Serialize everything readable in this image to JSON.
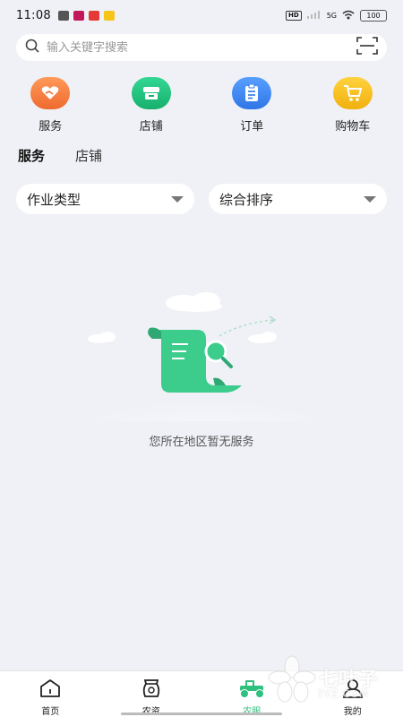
{
  "status_bar": {
    "time": "11:08",
    "network_label": "5G",
    "battery": "100"
  },
  "search": {
    "placeholder": "输入关键字搜索"
  },
  "quick_actions": [
    {
      "label": "服务",
      "icon": "heart-hand-icon",
      "color": "#f07a3a"
    },
    {
      "label": "店铺",
      "icon": "store-icon",
      "color": "#22c17f"
    },
    {
      "label": "订单",
      "icon": "order-clipboard-icon",
      "color": "#3a87f0"
    },
    {
      "label": "购物车",
      "icon": "cart-icon",
      "color": "#f3bd1f"
    }
  ],
  "tabs": [
    {
      "label": "服务",
      "active": true
    },
    {
      "label": "店铺",
      "active": false
    }
  ],
  "filters": {
    "type_label": "作业类型",
    "sort_label": "综合排序"
  },
  "empty_state": {
    "message": "您所在地区暂无服务"
  },
  "bottom_nav": [
    {
      "label": "首页",
      "icon": "home-icon"
    },
    {
      "label": "农资",
      "icon": "fertilizer-bag-icon"
    },
    {
      "label": "农服",
      "icon": "tractor-icon",
      "active": true
    },
    {
      "label": "我的",
      "icon": "person-icon"
    }
  ],
  "watermark": {
    "title": "七叶子",
    "subtitle": "7YZ.COM"
  },
  "colors": {
    "accent": "#2ec07f",
    "background": "#eff1f6"
  }
}
